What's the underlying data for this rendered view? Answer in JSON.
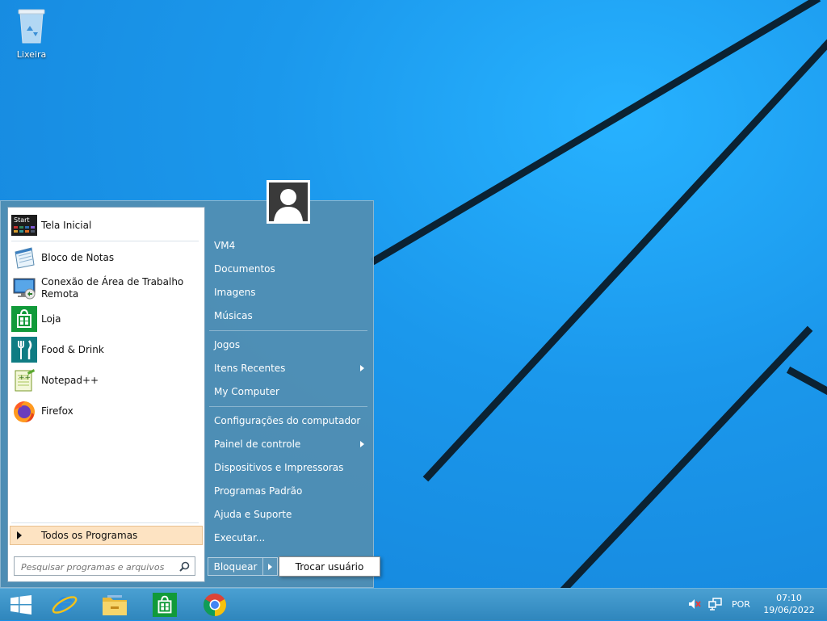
{
  "desktop": {
    "recycle_bin_label": "Lixeira"
  },
  "start_menu": {
    "pinned": [
      {
        "label": "Tela Inicial",
        "icon": "start-screen-icon"
      },
      {
        "label": "Bloco de Notas",
        "icon": "notepad-icon"
      },
      {
        "label": "Conexão de Área de Trabalho",
        "label2": "Remota",
        "icon": "remote-desktop-icon"
      },
      {
        "label": "Loja",
        "icon": "store-icon"
      },
      {
        "label": "Food & Drink",
        "icon": "food-drink-icon"
      },
      {
        "label": "Notepad++",
        "icon": "notepadpp-icon"
      },
      {
        "label": "Firefox",
        "icon": "firefox-icon"
      }
    ],
    "start_tile_text": "Start",
    "all_programs": "Todos os Programas",
    "search_placeholder": "Pesquisar programas e arquivos",
    "right_items": [
      {
        "label": "VM4"
      },
      {
        "label": "Documentos"
      },
      {
        "label": "Imagens"
      },
      {
        "label": "Músicas"
      },
      {
        "label": "Jogos"
      },
      {
        "label": "Itens Recentes",
        "submenu": true
      },
      {
        "label": "My Computer"
      },
      {
        "label": "Configurações do computador"
      },
      {
        "label": "Painel de controle",
        "submenu": true
      },
      {
        "label": "Dispositivos e Impressoras"
      },
      {
        "label": "Programas Padrão"
      },
      {
        "label": "Ajuda e Suporte"
      },
      {
        "label": "Executar..."
      }
    ],
    "lock_button": "Bloquear",
    "switch_user": "Trocar usuário"
  },
  "taskbar": {
    "apps": [
      "windows-start-icon",
      "internet-explorer-icon",
      "file-explorer-icon",
      "store-icon",
      "chrome-icon"
    ],
    "language": "POR",
    "time": "07:10",
    "date": "19/06/2022"
  },
  "colors": {
    "desktop_bg": "#1a8fe6",
    "menu_panel": "#528eb1",
    "taskbar": "#3e94c8",
    "all_programs_highlight": "#fde3c2"
  }
}
